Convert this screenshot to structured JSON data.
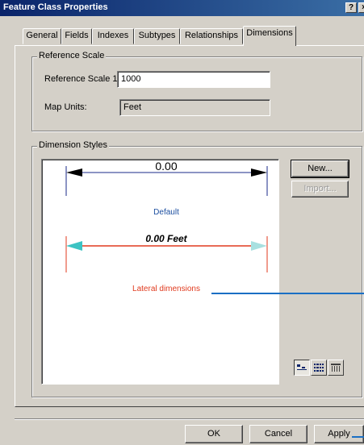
{
  "window": {
    "title": "Feature Class Properties",
    "help_glyph": "?",
    "close_glyph": "×"
  },
  "tabs": [
    {
      "label": "General"
    },
    {
      "label": "Fields"
    },
    {
      "label": "Indexes"
    },
    {
      "label": "Subtypes"
    },
    {
      "label": "Relationships"
    },
    {
      "label": "Dimensions",
      "active": true
    }
  ],
  "reference_scale": {
    "group_label": "Reference Scale",
    "scale_label": "Reference Scale 1:",
    "scale_value": "1000",
    "units_label": "Map Units:",
    "units_value": "Feet"
  },
  "dimension_styles": {
    "group_label": "Dimension Styles",
    "styles": [
      {
        "name": "Default",
        "dim_text": "0.00",
        "name_color": "#1c4fa0"
      },
      {
        "name": "Lateral dimensions",
        "dim_text": "0.00 Feet",
        "name_color": "#e03a1e"
      }
    ],
    "new_button": "New...",
    "import_button": "Import...",
    "view_buttons": [
      {
        "icon": "large-icons-view-icon"
      },
      {
        "icon": "list-view-icon"
      },
      {
        "icon": "details-view-icon"
      }
    ]
  },
  "footer": {
    "ok": "OK",
    "cancel": "Cancel",
    "apply": "Apply"
  },
  "colors": {
    "callout": "#1a6fc4",
    "lateral_line": "#e03a1e",
    "lateral_arrow": "#3cc3c3",
    "default_line": "#1a2a8a"
  }
}
